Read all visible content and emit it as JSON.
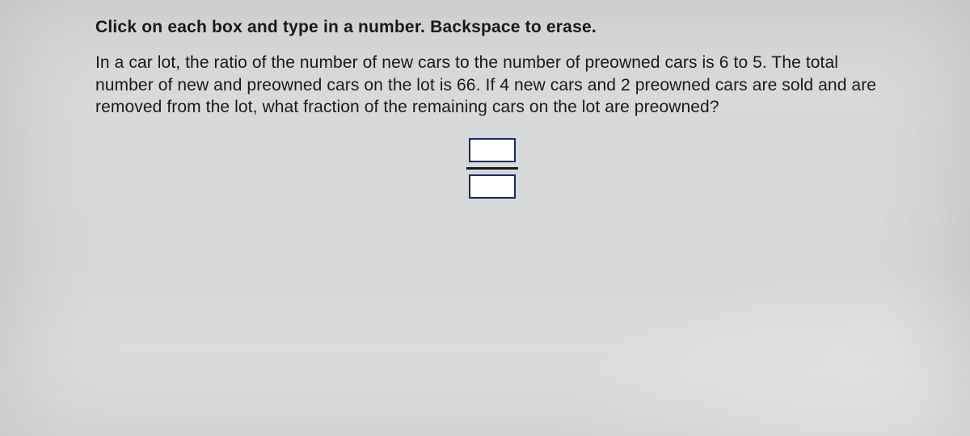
{
  "instruction": "Click on each box and type in a number. Backspace to erase.",
  "problem": "In a car lot, the ratio of the number of new cars to the number of preowned cars is 6 to 5. The total number of new and preowned cars on the lot is 66. If 4 new cars and 2 preowned cars are sold and are removed from the lot, what fraction of the remaining cars on the lot are preowned?",
  "fraction": {
    "numerator": "",
    "denominator": ""
  }
}
